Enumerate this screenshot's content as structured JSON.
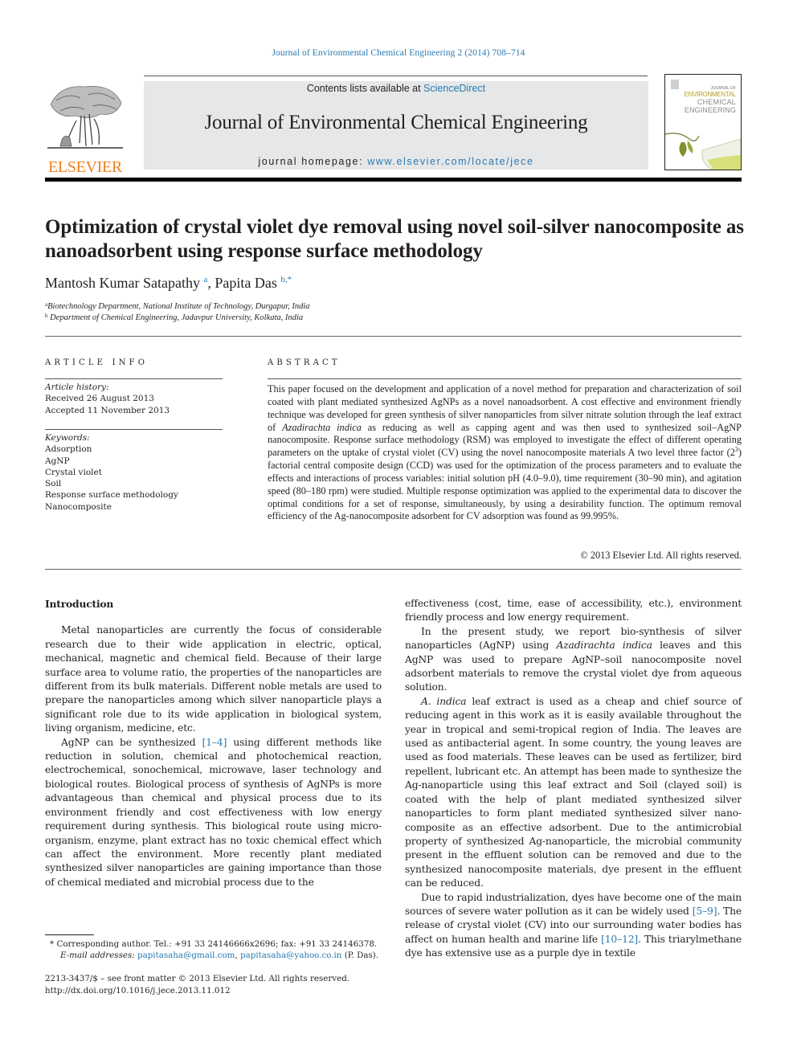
{
  "header": {
    "citation": "Journal of Environmental Chemical Engineering 2 (2014) 708–714",
    "contents_prefix": "Contents lists available at ",
    "contents_link": "ScienceDirect",
    "journal_title": "Journal of Environmental Chemical Engineering",
    "homepage_prefix": "journal homepage: ",
    "homepage_link": "www.elsevier.com/locate/jece",
    "publisher_logo_text": "ELSEVIER",
    "cover": {
      "line1": "JOURNAL OF",
      "line2": "ENVIRONMENTAL",
      "line3": "CHEMICAL",
      "line4": "ENGINEERING"
    }
  },
  "colors": {
    "link": "#2a7ab0",
    "elsevier_orange": "#f07f1a",
    "masthead_bg": "#e6e7e8"
  },
  "article": {
    "title": "Optimization of crystal violet dye removal using novel soil-silver nanocomposite as nanoadsorbent using response surface methodology",
    "authors": [
      {
        "name": "Mantosh Kumar Satapathy",
        "sup": "a"
      },
      {
        "name": "Papita Das",
        "sup": "b,*"
      }
    ],
    "author_separator": ", ",
    "affiliations": [
      {
        "mark": "a",
        "text": "Biotechnology Department, National Institute of Technology, Durgapur, India"
      },
      {
        "mark": "b",
        "text": "Department of Chemical Engineering, Jadavpur University, Kolkata, India"
      }
    ]
  },
  "article_info": {
    "label": "ARTICLE INFO",
    "history_label": "Article history:",
    "received": "Received 26 August 2013",
    "accepted": "Accepted 11 November 2013",
    "keywords_label": "Keywords:",
    "keywords": [
      "Adsorption",
      "AgNP",
      "Crystal violet",
      "Soil",
      "Response surface methodology",
      "Nanocomposite"
    ]
  },
  "abstract": {
    "label": "ABSTRACT",
    "part1": "This paper focused on the development and application of a novel method for preparation and characterization of soil coated with plant mediated synthesized AgNPs as a novel nanoadsorbent. A cost effective and environment friendly technique was developed for green synthesis of silver nanoparticles from silver nitrate solution through the leaf extract of ",
    "species": "Azadirachta indica",
    "part2": " as reducing as well as capping agent and was then used to synthesized soil–AgNP nanocomposite. Response surface methodology (RSM) was employed to investigate the effect of different operating parameters on the uptake of crystal violet (CV) using the novel nanocomposite materials A two level three factor (2",
    "sup": "3",
    "part3": ") factorial central composite design (CCD) was used for the optimization of the process parameters and to evaluate the effects and interactions of process variables: initial solution pH (4.0–9.0), time requirement (30–90 min), and agitation speed (80–180 rpm) were studied. Multiple response optimization was applied to the experimental data to discover the optimal conditions for a set of response, simultaneously, by using a desirability function. The optimum removal efficiency of the Ag-nanocomposite adsorbent for CV adsorption was found as 99.995%.",
    "copyright": "© 2013 Elsevier Ltd. All rights reserved."
  },
  "body": {
    "intro_heading": "Introduction",
    "left": {
      "p1": "Metal nanoparticles are currently the focus of considerable research due to their wide application in electric, optical, mechanical, magnetic and chemical field. Because of their large surface area to volume ratio, the properties of the nanoparticles are different from its bulk materials. Different noble metals are used to prepare the nanoparticles among which silver nanoparticle plays a significant role due to its wide application in biological system, living organism, medicine, etc.",
      "p2a": "AgNP can be synthesized ",
      "p2_ref": "[1–4]",
      "p2b": " using different methods like reduction in solution, chemical and photochemical reaction, electrochemical, sonochemical, microwave, laser technology and biological routes. Biological process of synthesis of AgNPs is more advantageous than chemical and physical process due to its environment friendly and cost effectiveness with low energy requirement during synthesis. This biological route using micro-organism, enzyme, plant extract has no toxic chemical effect which can affect the environment. More recently plant mediated synthesized silver nanoparticles are gaining importance than those of chemical mediated and microbial process due to the"
    },
    "right": {
      "p0": "effectiveness (cost, time, ease of accessibility, etc.), environment friendly process and low energy requirement.",
      "p1a": "In the present study, we report bio-synthesis of silver nanoparticles (AgNP) using ",
      "p1_species": "Azadirachta indica",
      "p1b": " leaves and this AgNP was used to prepare AgNP–soil nanocomposite novel adsorbent materials to remove the crystal violet dye from aqueous solution.",
      "p2_species": "A. indica",
      "p2": " leaf extract is used as a cheap and chief source of reducing agent in this work as it is easily available throughout the year in tropical and semi-tropical region of India. The leaves are used as antibacterial agent. In some country, the young leaves are used as food materials. These leaves can be used as fertilizer, bird repellent, lubricant etc. An attempt has been made to synthesize the Ag-nanoparticle using this leaf extract and Soil (clayed soil) is coated with the help of plant mediated synthesized silver nanoparticles to form plant mediated synthesized silver nano-composite as an effective adsorbent. Due to the antimicrobial property of synthesized Ag-nanoparticle, the microbial community present in the effluent solution can be removed and due to the synthesized nanocomposite materials, dye present in the effluent can be reduced.",
      "p3a": "Due to rapid industrialization, dyes have become one of the main sources of severe water pollution as it can be widely used ",
      "p3_ref1": "[5–9]",
      "p3b": ". The release of crystal violet (CV) into our surrounding water bodies has affect on human health and marine life ",
      "p3_ref2": "[10–12]",
      "p3c": ". This triarylmethane dye has extensive use as a purple dye in textile"
    }
  },
  "footnotes": {
    "star": "*",
    "corresponding": "Corresponding author. Tel.: +91 33 24146666x2696; fax: +91 33 24146378.",
    "email_label": "E-mail addresses:",
    "email1": "papitasaha@gmail.com",
    "email_sep": ", ",
    "email2": "papitasaha@yahoo.co.in",
    "email_suffix": " (P. Das).",
    "front_matter": "2213-3437/$ – see front matter © 2013 Elsevier Ltd. All rights reserved.",
    "doi": "http://dx.doi.org/10.1016/j.jece.2013.11.012"
  }
}
